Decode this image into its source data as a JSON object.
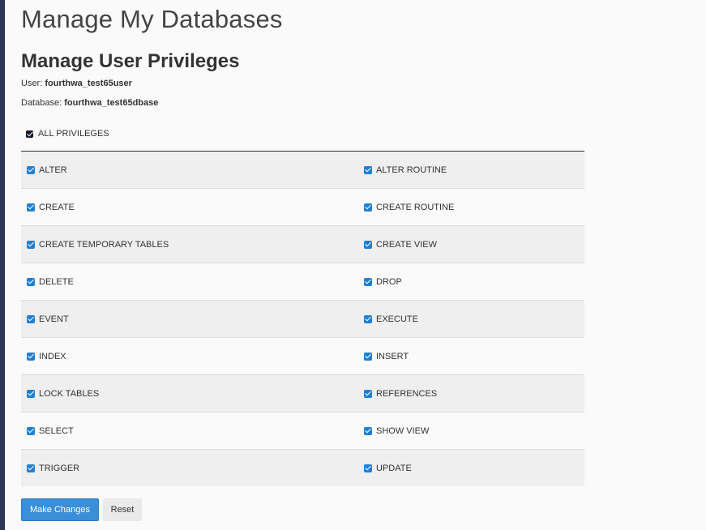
{
  "page": {
    "title": "Manage My Databases",
    "section_title": "Manage User Privileges",
    "user_label": "User:",
    "user_value": "fourthwa_test65user",
    "database_label": "Database:",
    "database_value": "fourthwa_test65dbase"
  },
  "all_privileges": {
    "label": "ALL PRIVILEGES",
    "checked": true
  },
  "privileges": [
    {
      "left": "ALTER",
      "right": "ALTER ROUTINE"
    },
    {
      "left": "CREATE",
      "right": "CREATE ROUTINE"
    },
    {
      "left": "CREATE TEMPORARY TABLES",
      "right": "CREATE VIEW"
    },
    {
      "left": "DELETE",
      "right": "DROP"
    },
    {
      "left": "EVENT",
      "right": "EXECUTE"
    },
    {
      "left": "INDEX",
      "right": "INSERT"
    },
    {
      "left": "LOCK TABLES",
      "right": "REFERENCES"
    },
    {
      "left": "SELECT",
      "right": "SHOW VIEW"
    },
    {
      "left": "TRIGGER",
      "right": "UPDATE"
    }
  ],
  "buttons": {
    "make_changes": "Make Changes",
    "reset": "Reset"
  },
  "colors": {
    "primary": "#3b8ed8",
    "checkbox": "#1f7fd6",
    "sidebar": "#2b3556"
  }
}
